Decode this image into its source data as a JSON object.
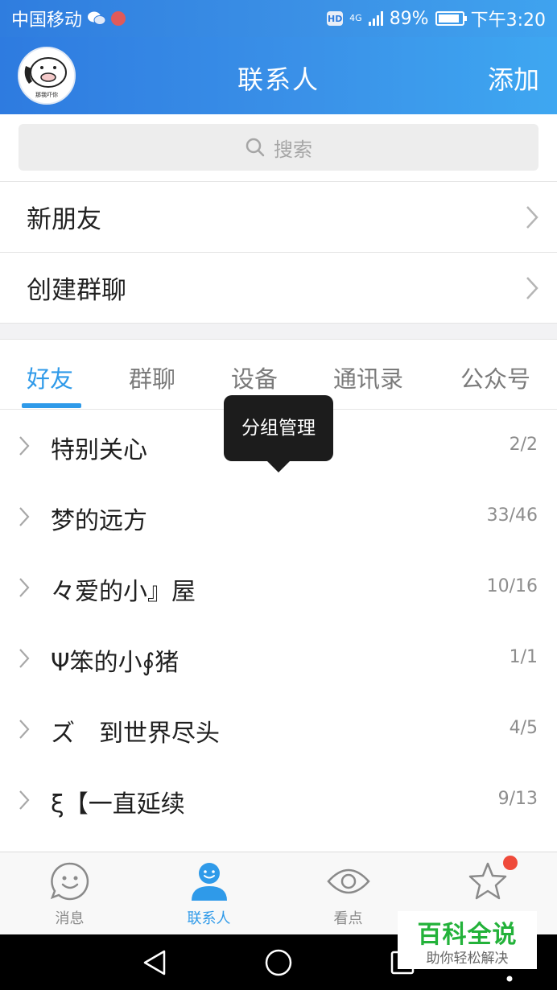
{
  "status_bar": {
    "carrier": "中国移动",
    "network": "4G",
    "battery": "89%",
    "time": "下午3:20",
    "battery_level": 0.89
  },
  "header": {
    "title": "联系人",
    "add_label": "添加",
    "avatar_caption": "那我吓你"
  },
  "search": {
    "placeholder": "搜索"
  },
  "menu_rows": [
    {
      "label": "新朋友"
    },
    {
      "label": "创建群聊"
    }
  ],
  "tabs": [
    {
      "label": "好友",
      "active": true
    },
    {
      "label": "群聊",
      "active": false
    },
    {
      "label": "设备",
      "active": false
    },
    {
      "label": "通讯录",
      "active": false
    },
    {
      "label": "公众号",
      "active": false
    }
  ],
  "tooltip": {
    "label": "分组管理"
  },
  "groups": [
    {
      "name": "特别关心",
      "count": "2/2"
    },
    {
      "name": "梦的远方",
      "count": "33/46"
    },
    {
      "name": "々爱的小』屋",
      "count": "10/16"
    },
    {
      "name": "Ψ笨的小∮猪",
      "count": "1/1"
    },
    {
      "name": "ズ　到世界尽头",
      "count": "4/5"
    },
    {
      "name": "ξ【一直延续",
      "count": "9/13"
    }
  ],
  "bottom_nav": [
    {
      "label": "消息",
      "icon": "smiley-icon",
      "active": false
    },
    {
      "label": "联系人",
      "icon": "contact-person-icon",
      "active": true
    },
    {
      "label": "看点",
      "icon": "eye-icon",
      "active": false
    },
    {
      "label": "",
      "icon": "star-icon",
      "active": false
    }
  ],
  "watermark": {
    "main": "百科全说",
    "sub": "助你轻松解决"
  },
  "colors": {
    "header_gradient_start": "#2e7be0",
    "header_gradient_end": "#3ea7f1",
    "accent": "#2f9ae9",
    "notification_dot": "#ef4a3a",
    "watermark_green": "#23b23a"
  }
}
